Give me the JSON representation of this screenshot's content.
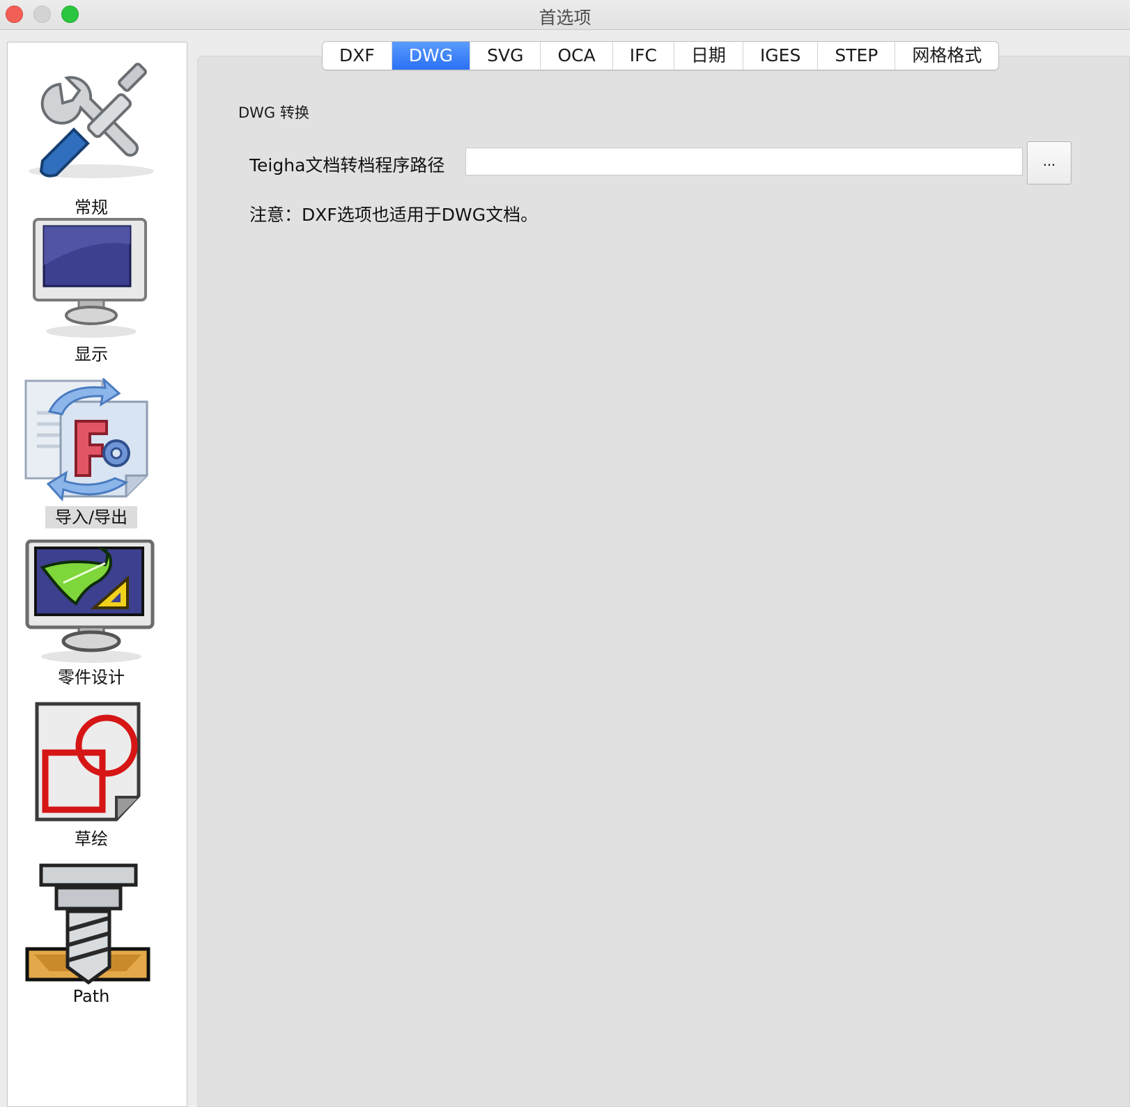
{
  "window": {
    "title": "首选项"
  },
  "sidebar": {
    "items": [
      {
        "label": "常规",
        "icon": "tools-icon"
      },
      {
        "label": "显示",
        "icon": "monitor-icon"
      },
      {
        "label": "导入/导出",
        "icon": "import-export-icon",
        "selected": true
      },
      {
        "label": "零件设计",
        "icon": "part-design-icon"
      },
      {
        "label": "草绘",
        "icon": "sketch-icon"
      },
      {
        "label": "Path",
        "icon": "path-drill-icon"
      }
    ]
  },
  "tabs": [
    "DXF",
    "DWG",
    "SVG",
    "OCA",
    "IFC",
    "日期",
    "IGES",
    "STEP",
    "网格格式"
  ],
  "active_tab": "DWG",
  "dwg": {
    "section_title": "DWG 转换",
    "path_label": "Teigha文档转档程序路径",
    "path_value": "",
    "browse_label": "...",
    "note": "注意：DXF选项也适用于DWG文档。"
  },
  "colors": {
    "accent": "#2a70f3",
    "panel_bg": "#e1e1e1"
  }
}
